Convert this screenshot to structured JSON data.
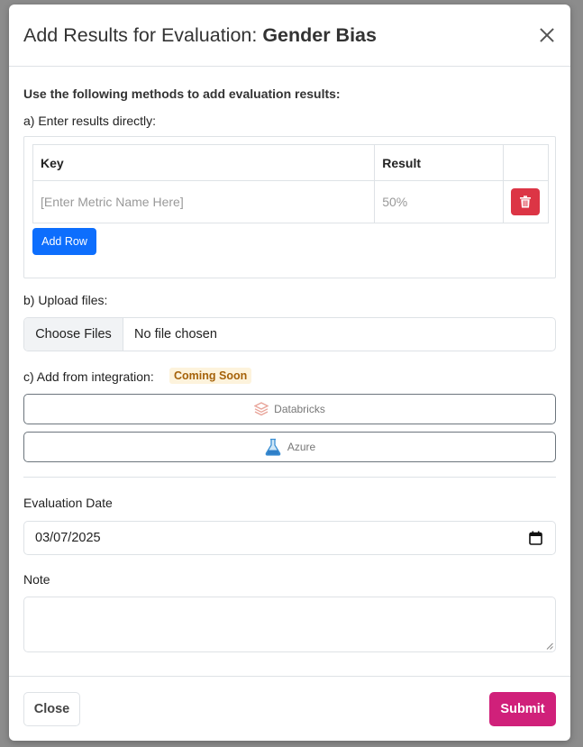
{
  "modal": {
    "title_prefix": "Add Results for Evaluation: ",
    "title_name": "Gender Bias",
    "lead": "Use the following methods to add evaluation results:",
    "section_a": "a) Enter results directly:",
    "table": {
      "headers": [
        "Key",
        "Result",
        ""
      ],
      "rows": [
        {
          "key_placeholder": "[Enter Metric Name Here]",
          "result_placeholder": "50%"
        }
      ]
    },
    "add_row_label": "Add Row",
    "section_b": "b) Upload files:",
    "choose_files_label": "Choose Files",
    "file_status": "No file chosen",
    "section_c": "c) Add from integration:",
    "coming_soon_badge": "Coming Soon",
    "integrations": [
      {
        "label": "Databricks",
        "icon": "databricks-icon"
      },
      {
        "label": "Azure",
        "icon": "azure-flask-icon"
      }
    ],
    "evaluation_date_label": "Evaluation Date",
    "evaluation_date_value": "03/07/2025",
    "note_label": "Note",
    "note_value": "",
    "close_label": "Close",
    "submit_label": "Submit"
  },
  "colors": {
    "primary": "#0d6efd",
    "danger": "#dc3545",
    "submit": "#d0207a",
    "badge_text": "#a5620a",
    "badge_bg": "#fdf3dc"
  }
}
